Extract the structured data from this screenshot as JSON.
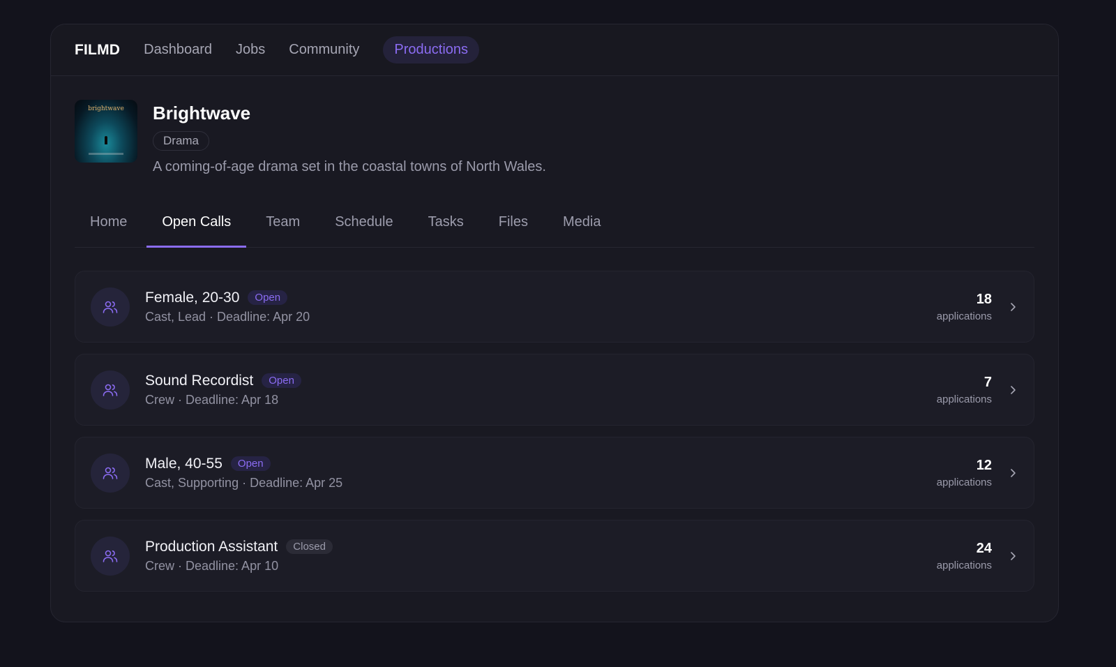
{
  "nav": {
    "brand": "FILMD",
    "items": [
      {
        "label": "Dashboard",
        "active": false
      },
      {
        "label": "Jobs",
        "active": false
      },
      {
        "label": "Community",
        "active": false
      },
      {
        "label": "Productions",
        "active": true
      }
    ]
  },
  "production": {
    "poster_text": "brightwave",
    "title": "Brightwave",
    "genre": "Drama",
    "description": "A coming-of-age drama set in the coastal towns of North Wales."
  },
  "tabs": [
    {
      "label": "Home",
      "active": false
    },
    {
      "label": "Open Calls",
      "active": true
    },
    {
      "label": "Team",
      "active": false
    },
    {
      "label": "Schedule",
      "active": false
    },
    {
      "label": "Tasks",
      "active": false
    },
    {
      "label": "Files",
      "active": false
    },
    {
      "label": "Media",
      "active": false
    }
  ],
  "open_calls": [
    {
      "title": "Female, 20-30",
      "status": "Open",
      "subtitle": "Cast, Lead · Deadline: Apr 20",
      "count": "18",
      "count_label": "applications"
    },
    {
      "title": "Sound Recordist",
      "status": "Open",
      "subtitle": "Crew · Deadline: Apr 18",
      "count": "7",
      "count_label": "applications"
    },
    {
      "title": "Male, 40-55",
      "status": "Open",
      "subtitle": "Cast, Supporting · Deadline: Apr 25",
      "count": "12",
      "count_label": "applications"
    },
    {
      "title": "Production Assistant",
      "status": "Closed",
      "subtitle": "Crew · Deadline: Apr 10",
      "count": "24",
      "count_label": "applications"
    }
  ],
  "colors": {
    "accent": "#8b6cf2",
    "background": "#13131c",
    "panel": "#191922"
  },
  "icons": {
    "call_icon": "users-icon",
    "row_action": "chevron-right-icon"
  }
}
